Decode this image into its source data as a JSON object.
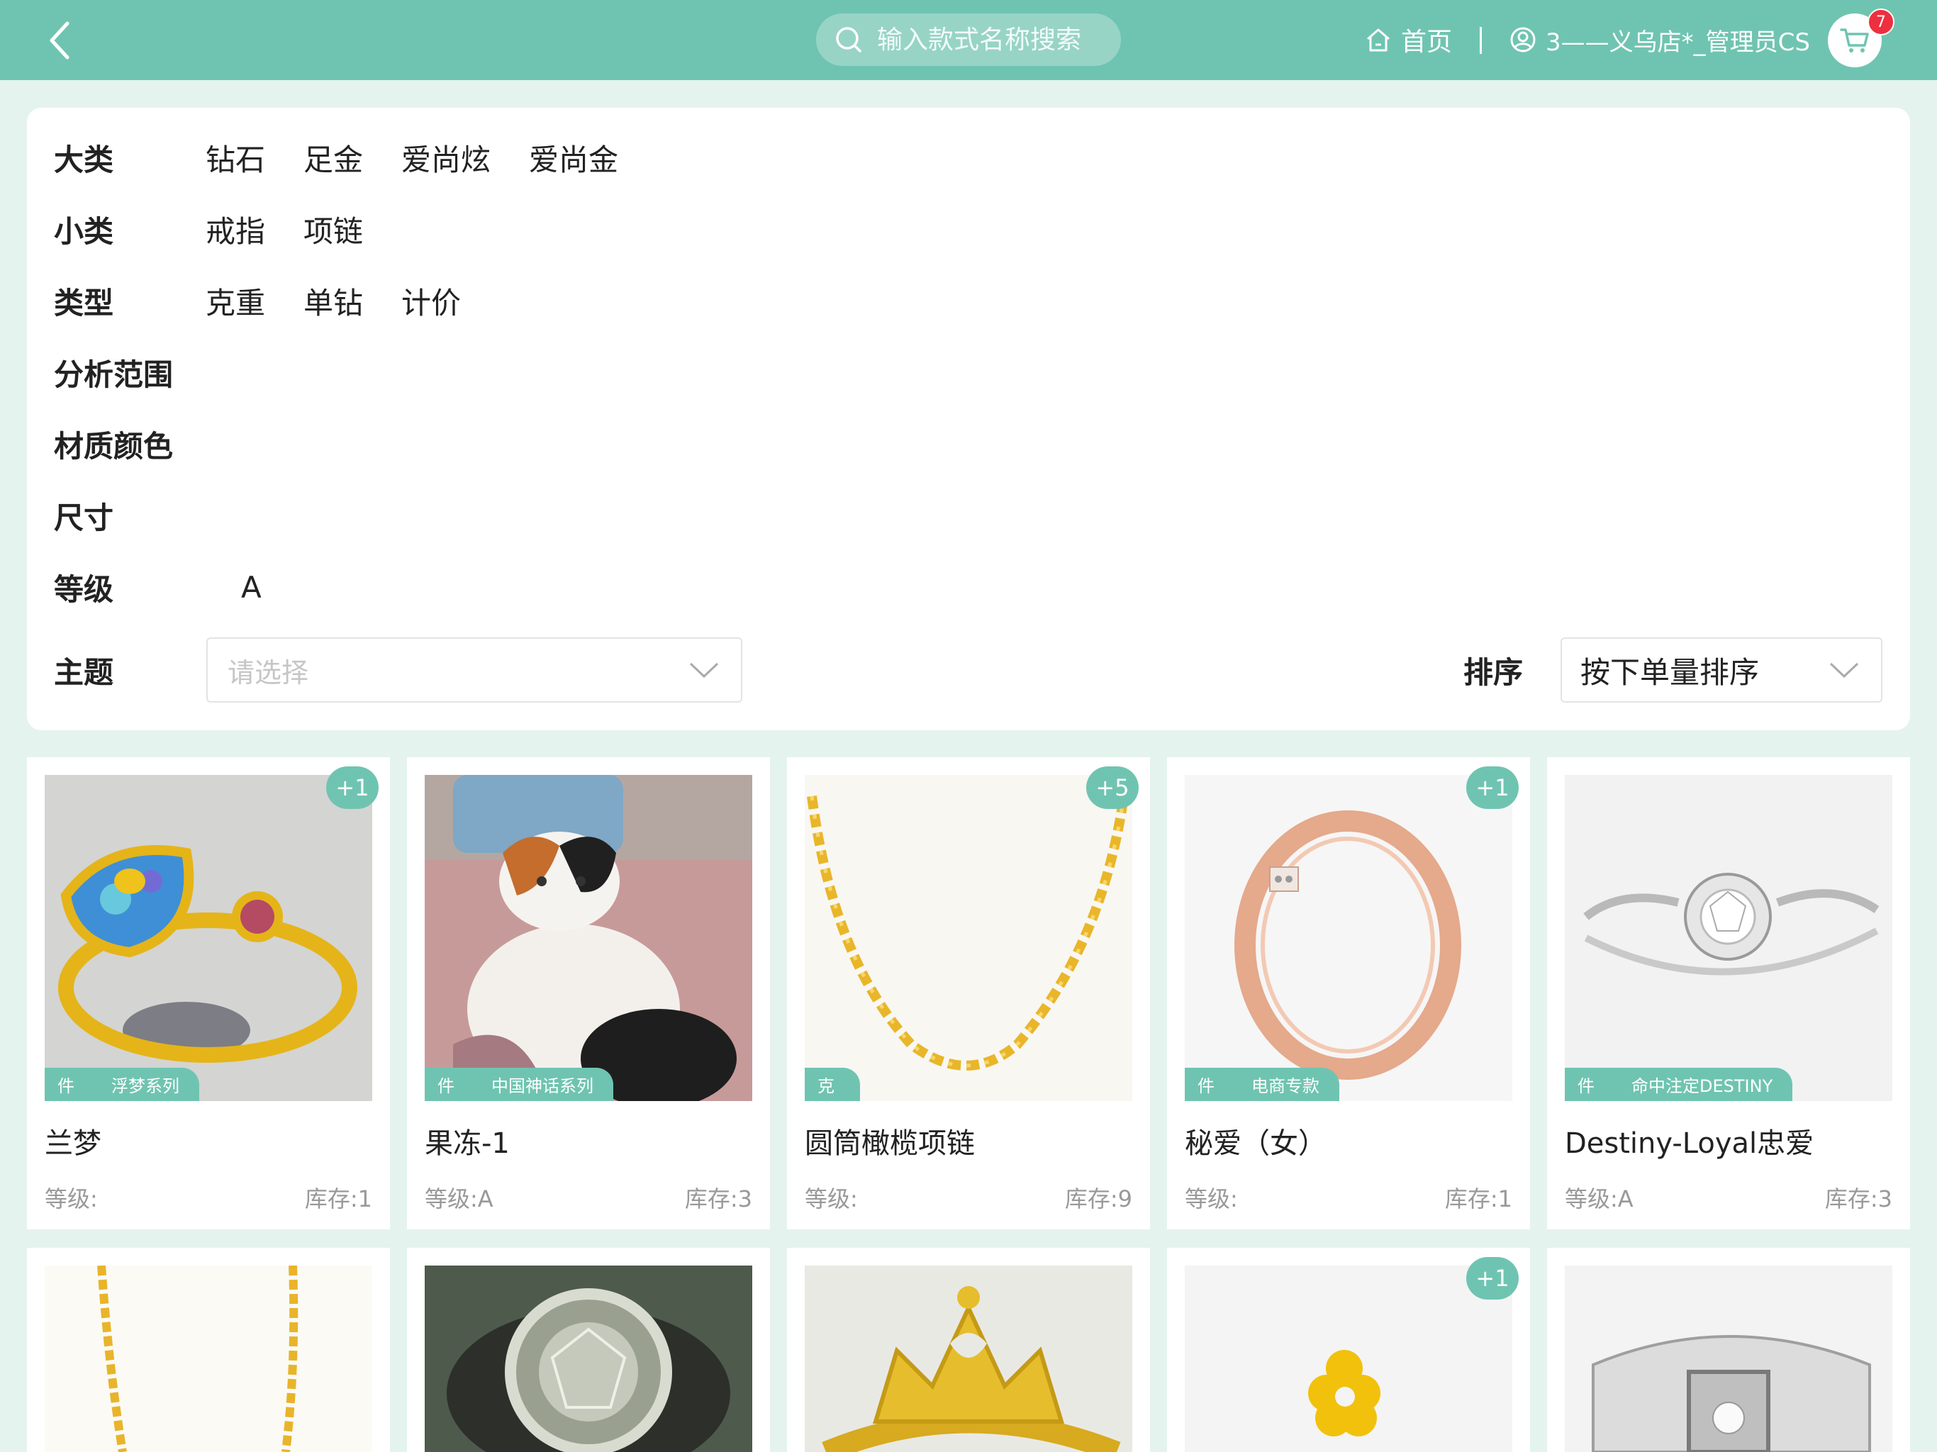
{
  "header": {
    "search_placeholder": "输入款式名称搜索",
    "home_label": "首页",
    "user_label": "3——义乌店*_管理员CS",
    "cart_count": "7"
  },
  "filters": {
    "category": {
      "label": "大类",
      "options": [
        "钻石",
        "足金",
        "爱尚炫",
        "爱尚金"
      ]
    },
    "subcategory": {
      "label": "小类",
      "options": [
        "戒指",
        "项链"
      ]
    },
    "type": {
      "label": "类型",
      "options": [
        "克重",
        "单钻",
        "计价"
      ]
    },
    "range": {
      "label": "分析范围"
    },
    "material": {
      "label": "材质颜色"
    },
    "size": {
      "label": "尺寸"
    },
    "grade": {
      "label": "等级",
      "options": [
        "A"
      ]
    },
    "theme": {
      "label": "主题",
      "placeholder": "请选择"
    },
    "sort": {
      "label": "排序",
      "value": "按下单量排序"
    }
  },
  "products": [
    {
      "name": "兰梦",
      "unit": "件",
      "series": "浮梦系列",
      "badge": "+1",
      "grade": "等级:",
      "stock": "库存:1",
      "image": "opal-gold-ring"
    },
    {
      "name": "果冻-1",
      "unit": "件",
      "series": "中国神话系列",
      "badge": "",
      "grade": "等级:A",
      "stock": "库存:3",
      "image": "cat-photo"
    },
    {
      "name": "圆筒橄榄项链",
      "unit": "克",
      "series": "",
      "badge": "+5",
      "grade": "等级:",
      "stock": "库存:9",
      "image": "gold-chain-necklace"
    },
    {
      "name": "秘爱（女）",
      "unit": "件",
      "series": "电商专款",
      "badge": "+1",
      "grade": "等级:",
      "stock": "库存:1",
      "image": "rose-gold-ring"
    },
    {
      "name": "Destiny-Loyal忠爱",
      "unit": "件",
      "series": "命中注定DESTINY",
      "badge": "",
      "grade": "等级:A",
      "stock": "库存:3",
      "image": "diamond-solitaire-ring"
    },
    {
      "name": "",
      "badge": "",
      "image": "gold-chain"
    },
    {
      "name": "",
      "badge": "",
      "image": "diamond-ring-dark"
    },
    {
      "name": "",
      "badge": "",
      "image": "gold-crown-ring"
    },
    {
      "name": "",
      "badge": "+1",
      "image": "gold-flower-ring"
    },
    {
      "name": "",
      "badge": "",
      "image": "silver-band-ring"
    }
  ]
}
